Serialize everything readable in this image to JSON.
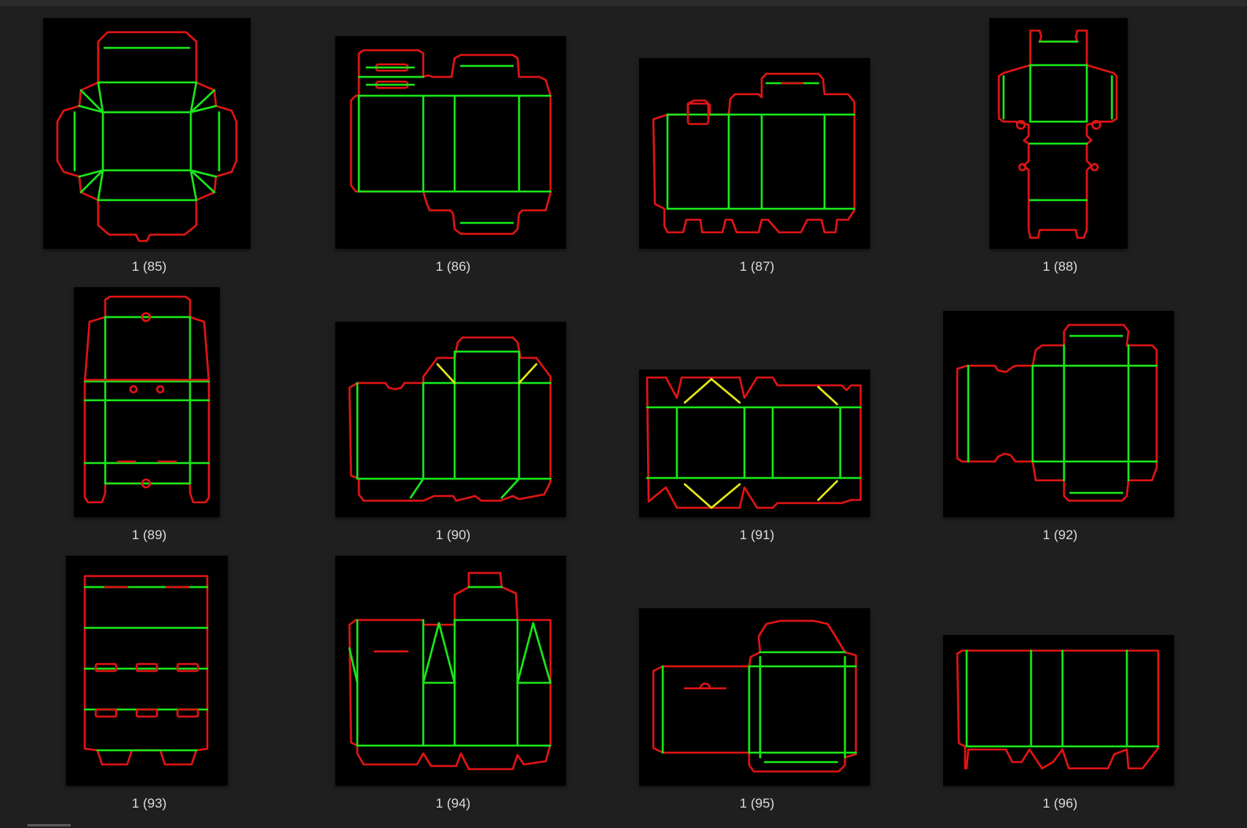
{
  "files": [
    {
      "name": "1 (85)",
      "icon": "dieline-thumbnail"
    },
    {
      "name": "1 (86)",
      "icon": "dieline-thumbnail"
    },
    {
      "name": "1 (87)",
      "icon": "dieline-thumbnail"
    },
    {
      "name": "1 (88)",
      "icon": "dieline-thumbnail"
    },
    {
      "name": "1 (89)",
      "icon": "dieline-thumbnail"
    },
    {
      "name": "1 (90)",
      "icon": "dieline-thumbnail"
    },
    {
      "name": "1 (91)",
      "icon": "dieline-thumbnail"
    },
    {
      "name": "1 (92)",
      "icon": "dieline-thumbnail"
    },
    {
      "name": "1 (93)",
      "icon": "dieline-thumbnail"
    },
    {
      "name": "1 (94)",
      "icon": "dieline-thumbnail"
    },
    {
      "name": "1 (95)",
      "icon": "dieline-thumbnail"
    },
    {
      "name": "1 (96)",
      "icon": "dieline-thumbnail"
    }
  ],
  "colors": {
    "background": "#1f1f1f",
    "thumbnail": "#000000",
    "cut_line": "#e01414",
    "crease_line": "#19e619",
    "bevel_line": "#e6e619",
    "caption": "#dcdcdc"
  }
}
